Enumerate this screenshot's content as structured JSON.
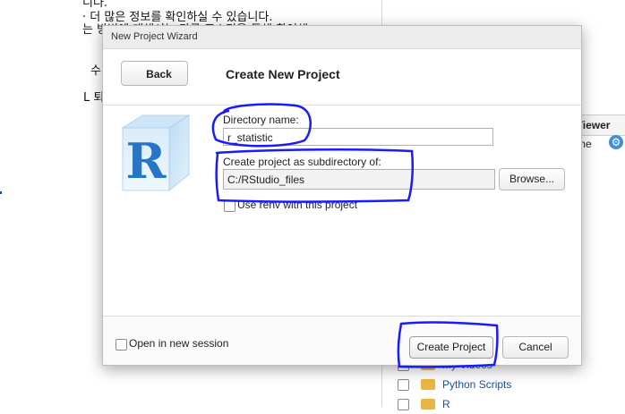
{
  "background": {
    "doc_lines": [
      "니다.",
      "· 더 많은 정보를 확인하실 수 있습니다.",
      "는 방법에 대해서는 다른 포스팅을 통해 확인해",
      "수",
      "L 퇴"
    ],
    "viewer_tab": "Viewer",
    "viewer_row": "me",
    "files": [
      "My Videos",
      "Python Scripts",
      "R"
    ]
  },
  "dialog": {
    "title": "New Project Wizard",
    "back_label": "Back",
    "header_title": "Create New Project",
    "directory_label": "Directory name:",
    "directory_value": "r_statistic",
    "subdir_label": "Create project as subdirectory of:",
    "subdir_value": "C:/RStudio_files",
    "browse_label": "Browse...",
    "renv_label": "Use renv with this project",
    "renv_checked": false,
    "new_session_label": "Open in new session",
    "new_session_checked": false,
    "create_label": "Create Project",
    "cancel_label": "Cancel"
  },
  "icons": {
    "logo": "r-logo-icon",
    "settings": "gear-icon",
    "folder": "folder-icon"
  },
  "colors": {
    "annotation": "#1a1aff",
    "r_blue": "#2776c6",
    "folder": "#e9b646"
  }
}
